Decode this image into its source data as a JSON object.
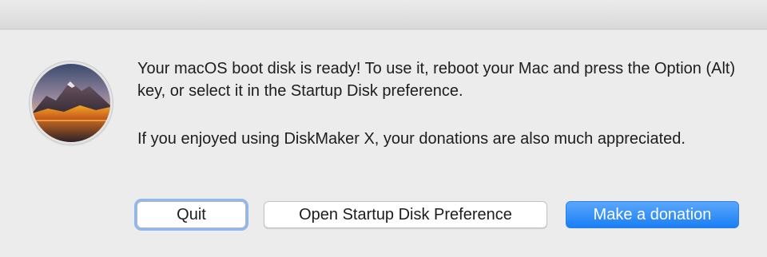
{
  "dialog": {
    "message": "Your macOS boot disk is ready! To use it, reboot your Mac and press the Option (Alt) key, or select it in the Startup Disk preference.",
    "info": "If you enjoyed using DiskMaker X, your donations are also much appreciated."
  },
  "buttons": {
    "quit": "Quit",
    "open_startup_disk": "Open Startup Disk Preference",
    "donate": "Make a donation"
  },
  "icon": {
    "name": "macos-high-sierra-icon"
  },
  "colors": {
    "accent": "#1a7ff5",
    "focus_ring": "#8db9f2"
  }
}
